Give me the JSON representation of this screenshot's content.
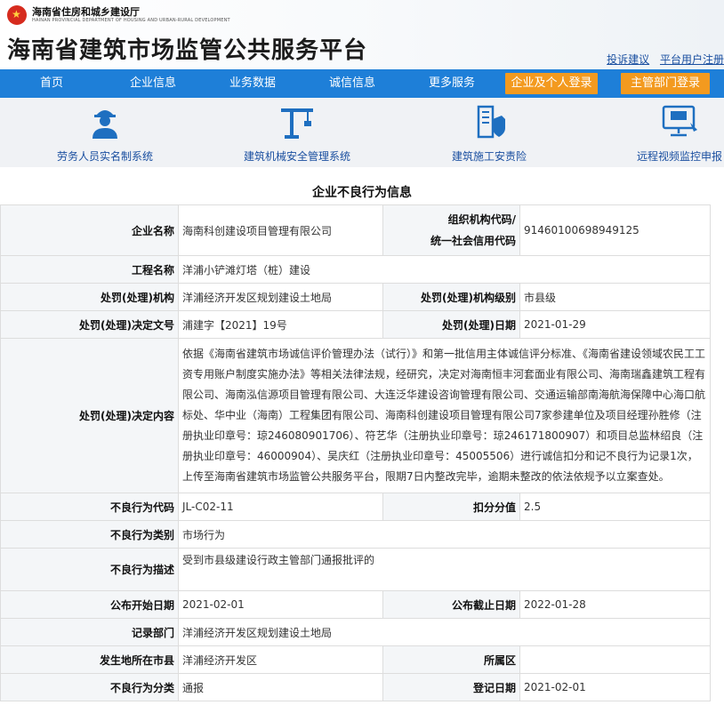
{
  "header": {
    "dept_name": "海南省住房和城乡建设厅",
    "dept_name_en": "HAINAN PROVINCIAL DEPARTMENT OF HOUSING AND URBAN-RURAL DEVELOPMENT",
    "site_title": "海南省建筑市场监管公共服务平台",
    "links": [
      "投诉建议",
      "平台用户注册"
    ]
  },
  "nav": {
    "items": [
      "首页",
      "企业信息",
      "业务数据",
      "诚信信息",
      "更多服务"
    ],
    "buttons": [
      "企业及个人登录",
      "主管部门登录"
    ]
  },
  "systems": [
    {
      "label": "劳务人员实名制系统",
      "icon": "worker-icon"
    },
    {
      "label": "建筑机械安全管理系统",
      "icon": "crane-icon"
    },
    {
      "label": "建筑施工安责险",
      "icon": "building-shield-icon"
    },
    {
      "label": "远程视频监控申报",
      "icon": "monitor-report-icon"
    }
  ],
  "section_title": "企业不良行为信息",
  "record": {
    "company_name_label": "企业名称",
    "company_name": "海南科创建设项目管理有限公司",
    "org_code_label_1": "组织机构代码/",
    "org_code_label_2": "统一社会信用代码",
    "org_code": "91460100698949125",
    "project_name_label": "工程名称",
    "project_name": "洋浦小铲滩灯塔（桩）建设",
    "penalty_org_label": "处罚(处理)机构",
    "penalty_org": "洋浦经济开发区规划建设土地局",
    "penalty_level_label": "处罚(处理)机构级别",
    "penalty_level": "市县级",
    "decision_no_label": "处罚(处理)决定文号",
    "decision_no": "浦建字【2021】19号",
    "penalty_date_label": "处罚(处理)日期",
    "penalty_date": "2021-01-29",
    "decision_content_label": "处罚(处理)决定内容",
    "decision_content": "依据《海南省建筑市场诚信评价管理办法（试行）》和第一批信用主体诚信评分标准、《海南省建设领域农民工工资专用账户制度实施办法》等相关法律法规，经研究，决定对海南恒丰河套面业有限公司、海南瑞鑫建筑工程有限公司、海南泓信源项目管理有限公司、大连泛华建设咨询管理有限公司、交通运输部南海航海保障中心海口航标处、华中业（海南）工程集团有限公司、海南科创建设项目管理有限公司7家参建单位及项目经理孙胜修（注册执业印章号：琼246080901706）、符艺华（注册执业印章号：琼246171800907）和项目总监林绍良（注册执业印章号：46000904）、吴庆红（注册执业印章号：45005506）进行诚信扣分和记不良行为记录1次，上传至海南省建筑市场监管公共服务平台，限期7日内整改完毕，逾期未整改的依法依规予以立案查处。",
    "behavior_code_label": "不良行为代码",
    "behavior_code": "JL-C02-11",
    "deduct_label": "扣分分值",
    "deduct": "2.5",
    "behavior_type_label": "不良行为类别",
    "behavior_type": "市场行为",
    "behavior_desc_label": "不良行为描述",
    "behavior_desc": "受到市县级建设行政主管部门通报批评的",
    "publish_start_label": "公布开始日期",
    "publish_start": "2021-02-01",
    "publish_end_label": "公布截止日期",
    "publish_end": "2022-01-28",
    "record_dept_label": "记录部门",
    "record_dept": "洋浦经济开发区规划建设土地局",
    "location_label": "发生地所在市县",
    "location": "洋浦经济开发区",
    "district_label": "所属区",
    "district": "",
    "category_label": "不良行为分类",
    "category": "通报",
    "register_date_label": "登记日期",
    "register_date": "2021-02-01"
  }
}
